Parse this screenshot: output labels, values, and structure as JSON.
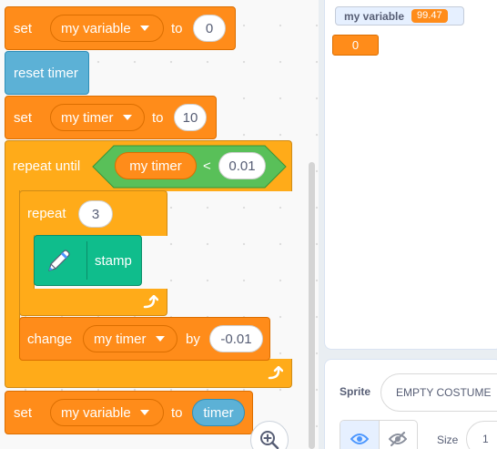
{
  "blocks": {
    "set_var": {
      "label": "set",
      "variable": "my variable",
      "to": "to",
      "value": "0"
    },
    "reset_timer": {
      "label": "reset timer"
    },
    "set_timer": {
      "label": "set",
      "variable": "my timer",
      "to": "to",
      "value": "10"
    },
    "repeat_until": {
      "label": "repeat until",
      "reporter": "my timer",
      "operator": "<",
      "value": "0.01"
    },
    "repeat": {
      "label": "repeat",
      "value": "3"
    },
    "stamp": {
      "label": "stamp",
      "icon": "pen-icon"
    },
    "change_timer": {
      "label": "change",
      "variable": "my timer",
      "by": "by",
      "value": "-0.01"
    },
    "set_var_timer": {
      "label": "set",
      "variable": "my variable",
      "to": "to",
      "reporter": "timer"
    }
  },
  "stage": {
    "monitor_label": "my variable",
    "monitor_value": "99.47",
    "list_value": "0"
  },
  "sprite_info": {
    "sprite_label": "Sprite",
    "sprite_name": "EMPTY COSTUME",
    "size_label": "Size",
    "size_value": "1"
  },
  "colors": {
    "events_orange": "#ff8c1a",
    "control_yellow": "#ffab19",
    "operators_green": "#59c059",
    "sensing_blue": "#5cb1d6",
    "pen_teal": "#0fbd8c"
  }
}
